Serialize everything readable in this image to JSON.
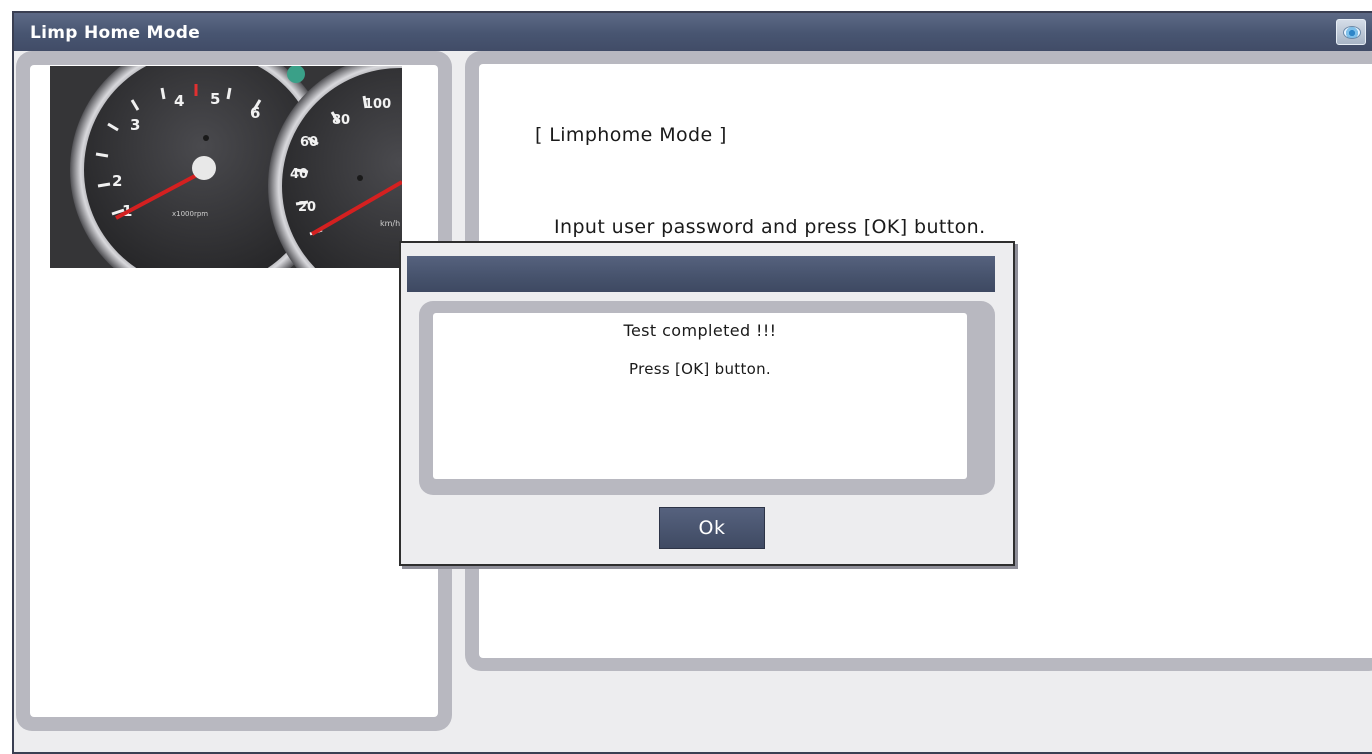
{
  "window": {
    "title": "Limp Home Mode"
  },
  "main": {
    "heading": "[ Limphome Mode ]",
    "instruction": "Input user password and press [OK] button."
  },
  "dialog": {
    "title": "",
    "message_line1": "Test completed !!!",
    "message_line2": "Press [OK] button.",
    "ok_label": "Ok"
  },
  "gauges": {
    "tach_ticks": [
      "1",
      "2",
      "3",
      "4",
      "5",
      "6"
    ],
    "tach_unit": "x1000rpm",
    "speedo_ticks": [
      "20",
      "40",
      "60",
      "80",
      "100"
    ],
    "speedo_unit": "km/h"
  },
  "colors": {
    "titlebar": "#485571",
    "panel_border": "#b8b8c0",
    "needle": "#d42020"
  },
  "icons": {
    "title_icon": "eye-icon"
  }
}
